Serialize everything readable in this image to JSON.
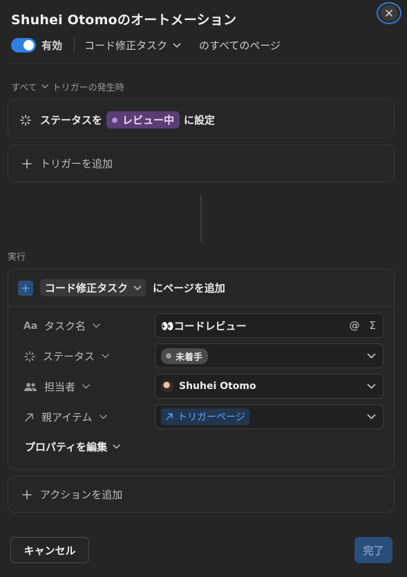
{
  "dialog": {
    "title": "Shuhei Otomoのオートメーション",
    "enabled_label": "有効",
    "database_name": "コード修正タスク",
    "database_suffix": "のすべてのページ"
  },
  "trigger": {
    "filter_all": "すべて",
    "filter_label": "トリガーの発生時",
    "prefix": "ステータスを",
    "status_value": "レビュー中",
    "suffix": "に設定",
    "add_label": "トリガーを追加"
  },
  "execution": {
    "section_label": "実行",
    "database_name": "コード修正タスク",
    "action_suffix": "にページを追加",
    "properties": [
      {
        "label": "タスク名",
        "value": "👀コードレビュー"
      },
      {
        "label": "ステータス",
        "value": "未着手"
      },
      {
        "label": "担当者",
        "value": "Shuhei Otomo"
      },
      {
        "label": "親アイテム",
        "value": "トリガーページ"
      }
    ],
    "mention_symbol": "@",
    "formula_symbol": "Σ",
    "edit_properties_label": "プロパティを編集",
    "add_action_label": "アクションを追加"
  },
  "footer": {
    "cancel_label": "キャンセル",
    "done_label": "完了"
  },
  "colors": {
    "accent_blue": "#2f7fe0",
    "review_status": "#b48bd6",
    "todo_status": "#9a9a9a",
    "link_blue": "#5aa2ff"
  },
  "icons": {
    "close": "close-icon",
    "chevron": "chevron-down-icon",
    "status": "status-spinner-icon",
    "plus": "plus-icon",
    "text_property": "text-property-icon",
    "people": "people-icon",
    "relation": "relation-arrow-icon"
  }
}
